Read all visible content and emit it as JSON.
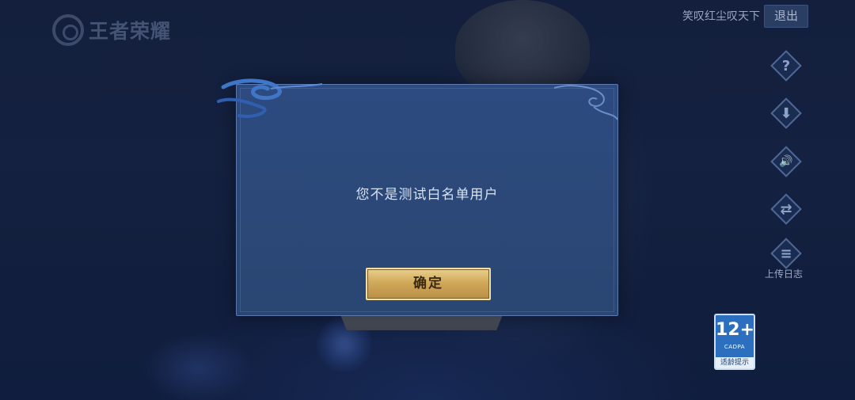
{
  "logo": {
    "text": "王者荣耀"
  },
  "header": {
    "user_name": "笑叹红尘叹天下",
    "logout_label": "退出"
  },
  "side_menu": {
    "items": [
      {
        "name": "help",
        "icon": "question-icon",
        "glyph": "?"
      },
      {
        "name": "repair",
        "icon": "download-icon",
        "glyph": "⬇"
      },
      {
        "name": "sound",
        "icon": "speaker-icon",
        "glyph": "🔊"
      },
      {
        "name": "switch",
        "icon": "exchange-icon",
        "glyph": "⇄"
      },
      {
        "name": "upload-log",
        "icon": "clipboard-icon",
        "glyph": "≡",
        "label": "上传日志"
      }
    ]
  },
  "age_rating": {
    "age": "12+",
    "org": "CADPA",
    "tip": "适龄提示"
  },
  "modal": {
    "message": "您不是测试白名单用户",
    "confirm_label": "确定"
  },
  "colors": {
    "background": "#1b2a4e",
    "modal": "#2d4b80",
    "button_gold": "#d1a95a"
  }
}
